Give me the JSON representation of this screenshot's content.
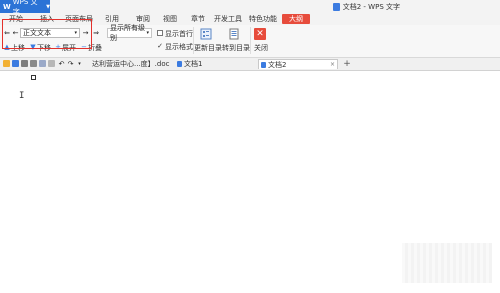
{
  "app": {
    "name": "WPS 文字",
    "window_title": "文档2 - WPS 文字",
    "brand_color": "#2b73d6"
  },
  "menu": {
    "items": [
      {
        "label": "开始"
      },
      {
        "label": "插入"
      },
      {
        "label": "页面布局"
      },
      {
        "label": "引用"
      },
      {
        "label": "审阅"
      },
      {
        "label": "视图"
      },
      {
        "label": "章节"
      },
      {
        "label": "开发工具"
      },
      {
        "label": "特色功能"
      },
      {
        "label": "大纲",
        "active": true
      }
    ]
  },
  "ribbon": {
    "outline_level_value": "正文文本",
    "display_level_value": "显示所有级别",
    "show_first_line_label": "显示首行",
    "show_format_label": "显示格式",
    "show_format_checked": true,
    "move_up_label": "上移",
    "move_down_label": "下移",
    "expand_label": "展开",
    "collapse_label": "折叠",
    "update_toc_label": "更新目录",
    "goto_toc_label": "转到目录",
    "close_label": "关闭",
    "highlight_color": "#e3312c"
  },
  "tabs": {
    "items": [
      {
        "label": "达利营运中心...度】.doc"
      },
      {
        "label": "文档1"
      },
      {
        "label": "文档2",
        "active": true
      }
    ],
    "add_label": "+"
  },
  "editor": {
    "cursor_glyph": "I"
  }
}
